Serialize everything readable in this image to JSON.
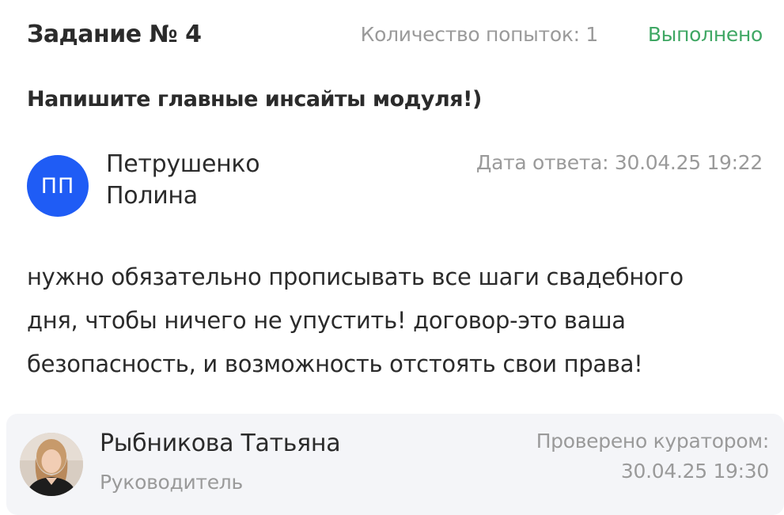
{
  "task": {
    "title": "Задание № 4",
    "attempts": "Количество попыток: 1",
    "status": "Выполнено",
    "status_color": "#3fa764"
  },
  "question": "Напишите главные инсайты модуля!)",
  "answer": {
    "author": {
      "initials": "ПП",
      "name_line1": "Петрушенко",
      "name_line2": "Полина",
      "avatar_color": "#1f5cf5"
    },
    "date_label": "Дата ответа: 30.04.25 19:22",
    "text_lines": [
      "нужно обязательно прописывать все шаги свадебного",
      "дня, чтобы ничего не упустить! договор-это ваша",
      "безопасность, и возможность отстоять свои права!"
    ]
  },
  "review": {
    "curator_name": "Рыбникова Татьяна",
    "curator_role": "Руководитель",
    "checked_label": "Проверено куратором:",
    "checked_date": "30.04.25 19:30",
    "photo_icon": "curator-photo"
  }
}
